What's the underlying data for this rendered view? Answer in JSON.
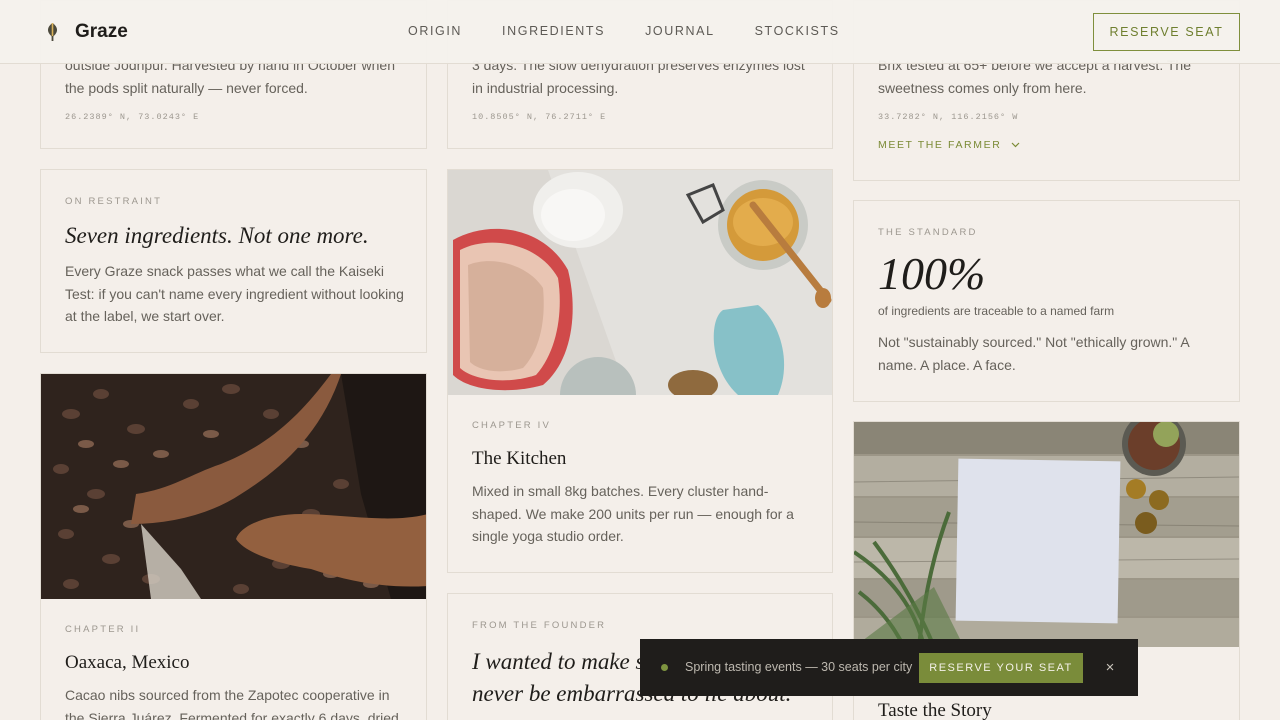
{
  "header": {
    "brand": "Graze",
    "nav": [
      "ORIGIN",
      "INGREDIENTS",
      "JOURNAL",
      "STOCKISTS"
    ],
    "reserve_label": "RESERVE SEAT"
  },
  "col1": {
    "top_card": {
      "body": "outside Jodhpur. Harvested by hand in October when the pods split naturally — never forced.",
      "coords": "26.2389° N, 73.0243° E"
    },
    "restraint": {
      "eyebrow": "ON RESTRAINT",
      "title": "Seven ingredients. Not one more.",
      "body": "Every Graze snack passes what we call the Kaiseki Test: if you can't name every ingredient without looking at the label, we start over."
    },
    "oaxaca": {
      "eyebrow": "CHAPTER II",
      "title": "Oaxaca, Mexico",
      "body": "Cacao nibs sourced from the Zapotec cooperative in the Sierra Juárez. Fermented for exactly 6 days, dried"
    }
  },
  "col2": {
    "top_card": {
      "body": "3 days. The slow dehydration preserves enzymes lost in industrial processing.",
      "coords": "10.8505° N, 76.2711° E"
    },
    "kitchen": {
      "eyebrow": "CHAPTER IV",
      "title": "The Kitchen",
      "body": "Mixed in small 8kg batches. Every cluster hand-shaped. We make 200 units per run — enough for a single yoga studio order."
    },
    "founder": {
      "eyebrow": "FROM THE FOUNDER",
      "quote": "I wanted to make something I'd never be embarrassed to lie about."
    }
  },
  "col3": {
    "top_card": {
      "body": "Brix tested at 65+ before we accept a harvest. The sweetness comes only from here.",
      "coords": "33.7282° N, 116.2156° W",
      "link": "MEET THE FARMER"
    },
    "standard": {
      "eyebrow": "THE STANDARD",
      "stat": "100%",
      "stat_caption": "of ingredients are traceable to a named farm",
      "body": "Not \"sustainably sourced.\" Not \"ethically grown.\" A name. A place. A face."
    },
    "story": {
      "title": "Taste the Story"
    }
  },
  "toast": {
    "text": "Spring tasting events — 30 seats per city",
    "button": "RESERVE YOUR SEAT",
    "close": "×"
  },
  "icons": {
    "logo": "leaf-logo-icon",
    "chevron": "chevron-down-icon",
    "close": "close-icon"
  },
  "colors": {
    "background": "#f4efea",
    "accent": "#7a8c3a",
    "toast_bg": "#1f1d1b"
  }
}
